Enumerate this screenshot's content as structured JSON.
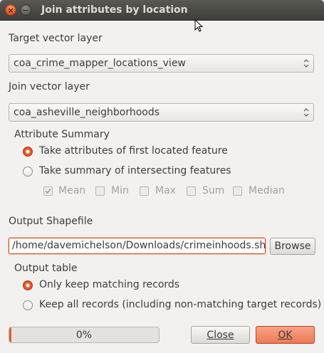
{
  "window": {
    "title": "Join attributes by location",
    "close_glyph": "×",
    "minimize_glyph": "−"
  },
  "target_layer": {
    "label": "Target vector layer",
    "value": "coa_crime_mapper_locations_view"
  },
  "join_layer": {
    "label": "Join vector layer",
    "value": "coa_asheville_neighborhoods"
  },
  "attribute_summary": {
    "title": "Attribute Summary",
    "option_first": "Take attributes of first located feature",
    "option_summary": "Take summary of intersecting features",
    "selected": "first",
    "stats": [
      {
        "label": "Mean",
        "checked": true
      },
      {
        "label": "Min",
        "checked": false
      },
      {
        "label": "Max",
        "checked": false
      },
      {
        "label": "Sum",
        "checked": false
      },
      {
        "label": "Median",
        "checked": false
      }
    ]
  },
  "output": {
    "label": "Output Shapefile",
    "path": "/home/davemichelson/Downloads/crimeinhoods.shp",
    "browse_label": "Browse"
  },
  "output_table": {
    "title": "Output table",
    "option_matching": "Only keep matching records",
    "option_all": "Keep all records (including non-matching target records)",
    "selected": "matching"
  },
  "footer": {
    "progress_text": "0%",
    "progress_fraction": 0.01,
    "close_label": "Close",
    "ok_label": "OK"
  },
  "colors": {
    "accent": "#dd4814",
    "titlebar": "#3c3b37"
  }
}
